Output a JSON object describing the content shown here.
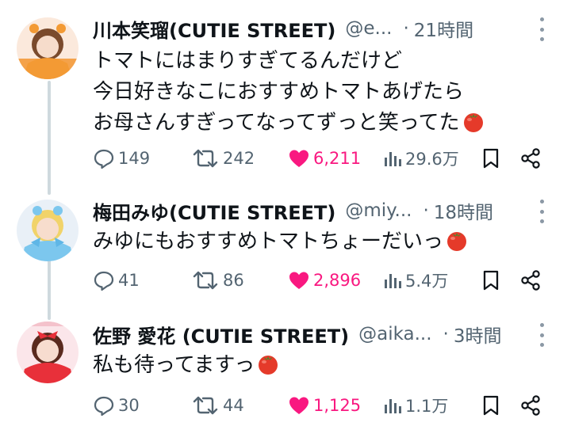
{
  "tweets": [
    {
      "name": "川本笑瑠(CUTIE STREET)",
      "handle": "@e...",
      "time": "21時間",
      "lines": [
        "トマトにはまりすぎてるんだけど",
        "今日好きなこにおすすめトマトあげたら",
        "お母さんすぎってなってずっと笑ってた"
      ],
      "replies": "149",
      "retweets": "242",
      "likes": "6,211",
      "views": "29.6万"
    },
    {
      "name": "梅田みゆ(CUTIE STREET)",
      "handle": "@miy...",
      "time": "18時間",
      "lines": [
        "みゆにもおすすめトマトちょーだいっ"
      ],
      "replies": "41",
      "retweets": "86",
      "likes": "2,896",
      "views": "5.4万"
    },
    {
      "name": "佐野 愛花 (CUTIE STREET)",
      "handle": "@aika...",
      "time": "3時間",
      "lines": [
        "私も待ってますっ"
      ],
      "replies": "30",
      "retweets": "44",
      "likes": "1,125",
      "views": "1.1万"
    }
  ],
  "icons": [
    "more-icon",
    "reply-icon",
    "retweet-icon",
    "heart-icon",
    "views-icon",
    "bookmark-icon",
    "share-icon",
    "tomato-emoji"
  ],
  "colors": {
    "like": "#f91880",
    "muted": "#536471",
    "text": "#0f1419",
    "thread": "#cfd9de"
  }
}
